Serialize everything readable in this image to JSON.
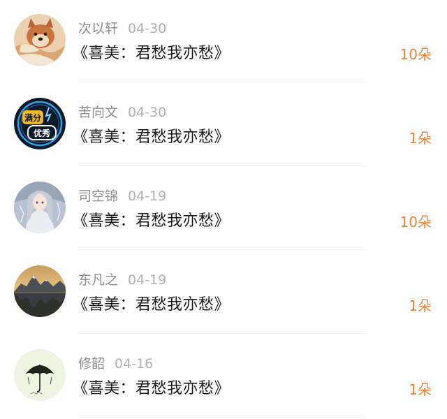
{
  "comments": [
    {
      "name": "次以轩",
      "date": "04-30",
      "title": "《喜美：君愁我亦愁》",
      "count": "10朵",
      "avatar": {
        "icon": "dog-blanket-avatar",
        "bg": "#e9c49e",
        "accent": "#c8743f"
      }
    },
    {
      "name": "苦向文",
      "date": "04-30",
      "title": "《喜美：君愁我亦愁》",
      "count": "1朵",
      "avatar": {
        "icon": "neon-badge-avatar",
        "bg": "#0d1a2a",
        "accent": "#f0b72d",
        "neon_top": "满分",
        "neon_bottom": "优秀"
      }
    },
    {
      "name": "司空锦",
      "date": "04-19",
      "title": "《喜美：君愁我亦愁》",
      "count": "10朵",
      "avatar": {
        "icon": "anime-girl-avatar",
        "bg": "#a9b4c4",
        "accent": "#6e7a90"
      }
    },
    {
      "name": "东凡之",
      "date": "04-19",
      "title": "《喜美：君愁我亦愁》",
      "count": "1朵",
      "avatar": {
        "icon": "mountain-lake-avatar",
        "bg": "#3a3a30",
        "accent": "#d9a25a"
      }
    },
    {
      "name": "修韶",
      "date": "04-16",
      "title": "《喜美：君愁我亦愁》",
      "count": "1朵",
      "avatar": {
        "icon": "umbrella-avatar",
        "bg": "#eef3e2",
        "accent": "#1f2418"
      }
    }
  ],
  "colors": {
    "count": "#e8843a",
    "name": "#8c8c8c",
    "date": "#b3b3b3",
    "title": "#1a1a1a",
    "divider": "#eeeeee"
  }
}
